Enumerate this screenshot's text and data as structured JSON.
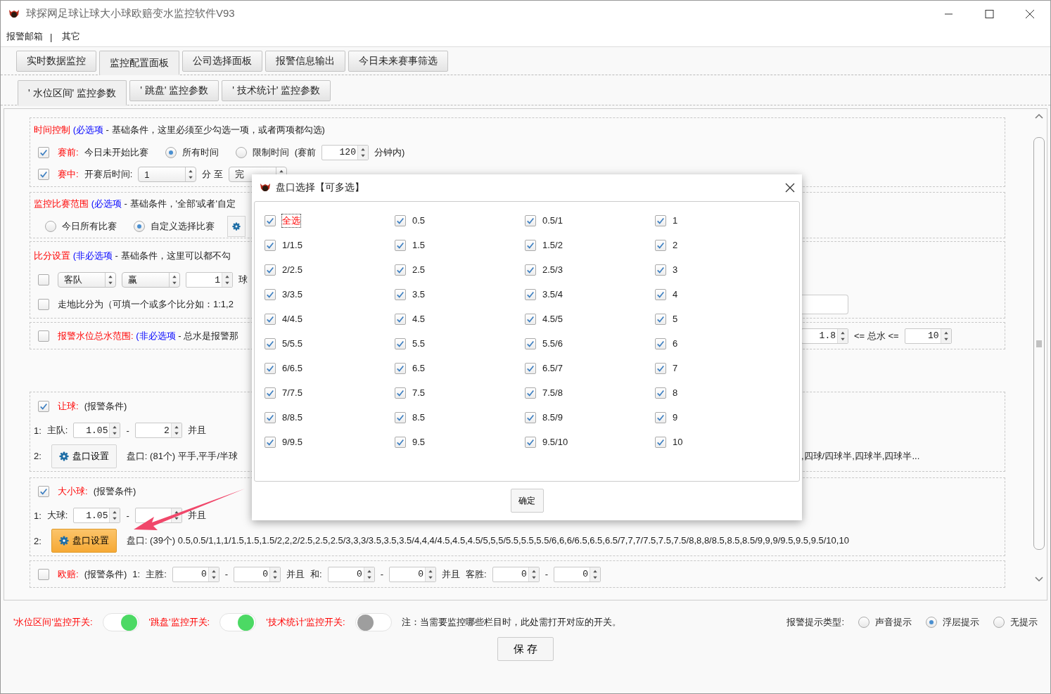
{
  "window": {
    "title": "球探网足球让球大小球欧赔变水监控软件V93"
  },
  "menu": {
    "items": [
      "报警邮箱",
      "其它"
    ],
    "separator": "|"
  },
  "tabs": [
    {
      "label": "实时数据监控",
      "selected": false
    },
    {
      "label": "监控配置面板",
      "selected": true
    },
    {
      "label": "公司选择面板",
      "selected": false
    },
    {
      "label": "报警信息输出",
      "selected": false
    },
    {
      "label": "今日未来赛事筛选",
      "selected": false
    }
  ],
  "subtabs": [
    {
      "label": "' 水位区间' 监控参数",
      "selected": true
    },
    {
      "label": "' 跳盘' 监控参数",
      "selected": false
    },
    {
      "label": "' 技术统计' 监控参数",
      "selected": false
    }
  ],
  "sections": [
    {
      "rows": [
        {
          "items": [
            {
              "kind": "header",
              "title": "时间控制",
              "tag": "(必选项",
              "note": " - 基础条件，这里必须至少勾选一项，或者两项都勾选)"
            }
          ]
        },
        {
          "items": [
            {
              "kind": "check",
              "checked": true
            },
            {
              "kind": "alert",
              "text": "赛前:"
            },
            {
              "kind": "text",
              "text": "今日未开始比赛"
            },
            {
              "kind": "radio",
              "label": "所有时间",
              "selected": true
            },
            {
              "kind": "radio",
              "label": "限制时间",
              "selected": false
            },
            {
              "kind": "text",
              "text": "(赛前"
            },
            {
              "kind": "spin",
              "value": "120"
            },
            {
              "kind": "text",
              "text": "分钟内)"
            }
          ]
        },
        {
          "items": [
            {
              "kind": "check",
              "checked": true
            },
            {
              "kind": "alert",
              "text": "赛中:"
            },
            {
              "kind": "text",
              "text": "开赛后时间:"
            },
            {
              "kind": "select",
              "value": "1"
            },
            {
              "kind": "text",
              "text": "分 至"
            },
            {
              "kind": "select",
              "value": "完"
            }
          ]
        }
      ]
    },
    {
      "rows": [
        {
          "items": [
            {
              "kind": "header",
              "title": "监控比赛范围",
              "tag": "(必选项",
              "note": " - 基础条件，'全部'或者'自定"
            }
          ]
        },
        {
          "items": [
            {
              "kind": "radio",
              "label": "今日所有比赛",
              "selected": false
            },
            {
              "kind": "radio",
              "label": "自定义选择比赛",
              "selected": true
            },
            {
              "kind": "iconbutton"
            }
          ]
        }
      ]
    },
    {
      "rows": [
        {
          "items": [
            {
              "kind": "header",
              "title": "比分设置",
              "tag": "(非必选项",
              "note": " - 基础条件，这里可以都不勾"
            }
          ]
        },
        {
          "items": [
            {
              "kind": "check",
              "checked": false
            },
            {
              "kind": "select",
              "value": "客队"
            },
            {
              "kind": "select",
              "value": "赢"
            },
            {
              "kind": "spin",
              "value": "1"
            },
            {
              "kind": "text",
              "text": "球"
            }
          ]
        },
        {
          "items": [
            {
              "kind": "check",
              "checked": false
            },
            {
              "kind": "text",
              "text": "走地比分为（可填一个或多个比分如：1:1,2"
            }
          ],
          "right": [
            {
              "kind": "field"
            }
          ]
        }
      ]
    },
    {
      "rows": [
        {
          "items": [
            {
              "kind": "check",
              "checked": false
            },
            {
              "kind": "header",
              "title": "报警水位总水范围:",
              "tag": " (非必选项",
              "note": " - 总水是报警那"
            }
          ],
          "right": [
            {
              "kind": "spin",
              "value": "1.8"
            },
            {
              "kind": "text",
              "text": "<=  总水  <="
            },
            {
              "kind": "spin",
              "value": "10"
            }
          ]
        }
      ]
    },
    {
      "rows": [
        {
          "items": [
            {
              "kind": "check",
              "checked": true
            },
            {
              "kind": "alert",
              "text": "让球:"
            },
            {
              "kind": "text",
              "text": "(报警条件)"
            }
          ]
        },
        {
          "items": [
            {
              "kind": "text",
              "text": "1:"
            },
            {
              "kind": "text",
              "text": "主队:"
            },
            {
              "kind": "spin",
              "value": "1.05"
            },
            {
              "kind": "text",
              "text": "-"
            },
            {
              "kind": "spin",
              "value": "2"
            },
            {
              "kind": "text",
              "text": "并且"
            }
          ]
        },
        {
          "items": [
            {
              "kind": "text",
              "text": "2:"
            },
            {
              "kind": "button",
              "label": "盘口设置",
              "highlighted": false
            },
            {
              "kind": "text",
              "text": "盘口: (81个) 平手,平手/半球"
            }
          ],
          "right": [
            {
              "kind": "text",
              "text": ",四球/四球半,四球半,四球半..."
            }
          ]
        }
      ]
    },
    {
      "rows": [
        {
          "items": [
            {
              "kind": "check",
              "checked": true
            },
            {
              "kind": "alert",
              "text": "大小球:"
            },
            {
              "kind": "text",
              "text": "(报警条件)"
            }
          ]
        },
        {
          "items": [
            {
              "kind": "text",
              "text": "1:"
            },
            {
              "kind": "text",
              "text": "大球:"
            },
            {
              "kind": "spin",
              "value": "1.05"
            },
            {
              "kind": "text",
              "text": "-"
            },
            {
              "kind": "spin"
            },
            {
              "kind": "text",
              "text": "并且"
            }
          ]
        },
        {
          "items": [
            {
              "kind": "text",
              "text": "2:"
            },
            {
              "kind": "button",
              "label": "盘口设置",
              "highlighted": true
            },
            {
              "kind": "text",
              "text": "盘口: (39个) 0.5,0.5/1,1,1/1.5,1.5,1.5/2,2,2/2.5,2.5,2.5/3,3,3/3.5,3.5,3.5/4,4,4/4.5,4.5,4.5/5,5,5/5.5,5.5,5.5/6,6,6/6.5,6.5,6.5/7,7,7/7.5,7.5,7.5/8,8,8/8.5,8.5,8.5/9,9,9/9.5,9.5,9.5/10,10"
            }
          ]
        }
      ]
    },
    {
      "rows": [
        {
          "items": [
            {
              "kind": "check",
              "checked": false
            },
            {
              "kind": "alert",
              "text": "欧赔:"
            },
            {
              "kind": "text",
              "text": "(报警条件)"
            },
            {
              "kind": "text",
              "text": "1:"
            },
            {
              "kind": "text",
              "text": "主胜:"
            },
            {
              "kind": "spin",
              "value": "0"
            },
            {
              "kind": "text",
              "text": "-"
            },
            {
              "kind": "spin",
              "value": "0"
            },
            {
              "kind": "text",
              "text": "并且"
            },
            {
              "kind": "text",
              "text": "和:"
            },
            {
              "kind": "spin",
              "value": "0"
            },
            {
              "kind": "text",
              "text": "-"
            },
            {
              "kind": "spin",
              "value": "0"
            },
            {
              "kind": "text",
              "text": "并且"
            },
            {
              "kind": "text",
              "text": "客胜:"
            },
            {
              "kind": "spin",
              "value": "0"
            },
            {
              "kind": "text",
              "text": "-"
            },
            {
              "kind": "spin",
              "value": "0"
            }
          ]
        }
      ]
    }
  ],
  "footer": {
    "switches": [
      {
        "label": "'水位区间'监控开关:",
        "on": true
      },
      {
        "label": "'跳盘'监控开关:",
        "on": true
      },
      {
        "label": "'技术统计'监控开关:",
        "on": false
      }
    ],
    "note": "注：当需要监控哪些栏目时，此处需打开对应的开关。",
    "alert_type": {
      "label": "报警提示类型:",
      "options": [
        {
          "label": "声音提示",
          "selected": false
        },
        {
          "label": "浮层提示",
          "selected": true
        },
        {
          "label": "无提示",
          "selected": false
        }
      ]
    },
    "save": "保 存"
  },
  "dialog": {
    "title": "盘口选择【可多选】",
    "confirm": "确定",
    "options": [
      {
        "kind": "all",
        "label": "全选",
        "checked": true
      },
      {
        "kind": "value",
        "label": "0.5",
        "checked": true
      },
      {
        "kind": "value",
        "label": "0.5/1",
        "checked": true
      },
      {
        "kind": "value",
        "label": "1",
        "checked": true
      },
      {
        "kind": "value",
        "label": "1/1.5",
        "checked": true
      },
      {
        "kind": "value",
        "label": "1.5",
        "checked": true
      },
      {
        "kind": "value",
        "label": "1.5/2",
        "checked": true
      },
      {
        "kind": "value",
        "label": "2",
        "checked": true
      },
      {
        "kind": "value",
        "label": "2/2.5",
        "checked": true
      },
      {
        "kind": "value",
        "label": "2.5",
        "checked": true
      },
      {
        "kind": "value",
        "label": "2.5/3",
        "checked": true
      },
      {
        "kind": "value",
        "label": "3",
        "checked": true
      },
      {
        "kind": "value",
        "label": "3/3.5",
        "checked": true
      },
      {
        "kind": "value",
        "label": "3.5",
        "checked": true
      },
      {
        "kind": "value",
        "label": "3.5/4",
        "checked": true
      },
      {
        "kind": "value",
        "label": "4",
        "checked": true
      },
      {
        "kind": "value",
        "label": "4/4.5",
        "checked": true
      },
      {
        "kind": "value",
        "label": "4.5",
        "checked": true
      },
      {
        "kind": "value",
        "label": "4.5/5",
        "checked": true
      },
      {
        "kind": "value",
        "label": "5",
        "checked": true
      },
      {
        "kind": "value",
        "label": "5/5.5",
        "checked": true
      },
      {
        "kind": "value",
        "label": "5.5",
        "checked": true
      },
      {
        "kind": "value",
        "label": "5.5/6",
        "checked": true
      },
      {
        "kind": "value",
        "label": "6",
        "checked": true
      },
      {
        "kind": "value",
        "label": "6/6.5",
        "checked": true
      },
      {
        "kind": "value",
        "label": "6.5",
        "checked": true
      },
      {
        "kind": "value",
        "label": "6.5/7",
        "checked": true
      },
      {
        "kind": "value",
        "label": "7",
        "checked": true
      },
      {
        "kind": "value",
        "label": "7/7.5",
        "checked": true
      },
      {
        "kind": "value",
        "label": "7.5",
        "checked": true
      },
      {
        "kind": "value",
        "label": "7.5/8",
        "checked": true
      },
      {
        "kind": "value",
        "label": "8",
        "checked": true
      },
      {
        "kind": "value",
        "label": "8/8.5",
        "checked": true
      },
      {
        "kind": "value",
        "label": "8.5",
        "checked": true
      },
      {
        "kind": "value",
        "label": "8.5/9",
        "checked": true
      },
      {
        "kind": "value",
        "label": "9",
        "checked": true
      },
      {
        "kind": "value",
        "label": "9/9.5",
        "checked": true
      },
      {
        "kind": "value",
        "label": "9.5",
        "checked": true
      },
      {
        "kind": "value",
        "label": "9.5/10",
        "checked": true
      },
      {
        "kind": "value",
        "label": "10",
        "checked": true
      }
    ]
  }
}
